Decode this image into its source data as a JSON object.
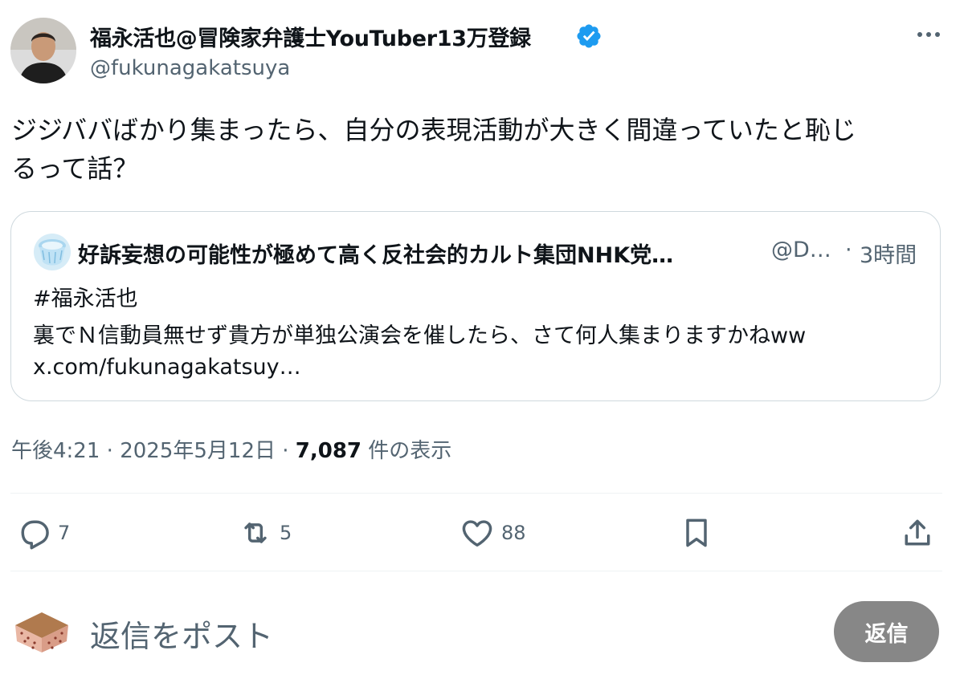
{
  "author": {
    "display_name": "福永活也@冒険家弁護士YouTuber13万登録",
    "handle": "@fukunagakatsuya",
    "verified_icon": "verified-badge-icon"
  },
  "tweet": {
    "line1": "ジジババばかり集まったら、自分の表現活動が大きく間違っていたと恥じ",
    "line2": "るって話？"
  },
  "quoted": {
    "display_name": "好訴妄想の可能性が極めて高く反社会的カルト集団NHK党…",
    "handle": "@D…",
    "separator": "·",
    "time": "3時間",
    "line1": "#福永活也",
    "line2": "裏でＮ信動員無せず貴方が単独公演会を催したら、さて何人集まりますかねww",
    "line3": "x.com/fukunagakatsuy…"
  },
  "meta": {
    "time": "午後4:21",
    "sep1": "·",
    "date": "2025年5月12日",
    "sep2": "·",
    "views": "7,087",
    "views_label": "件の表示"
  },
  "actions": {
    "replies": "7",
    "reposts": "5",
    "likes": "88"
  },
  "reply_box": {
    "placeholder": "返信をポスト",
    "button_label": "返信"
  },
  "colors": {
    "accent_blue": "#1d9bf0",
    "muted_text": "#536471",
    "button_gray": "#878787"
  }
}
